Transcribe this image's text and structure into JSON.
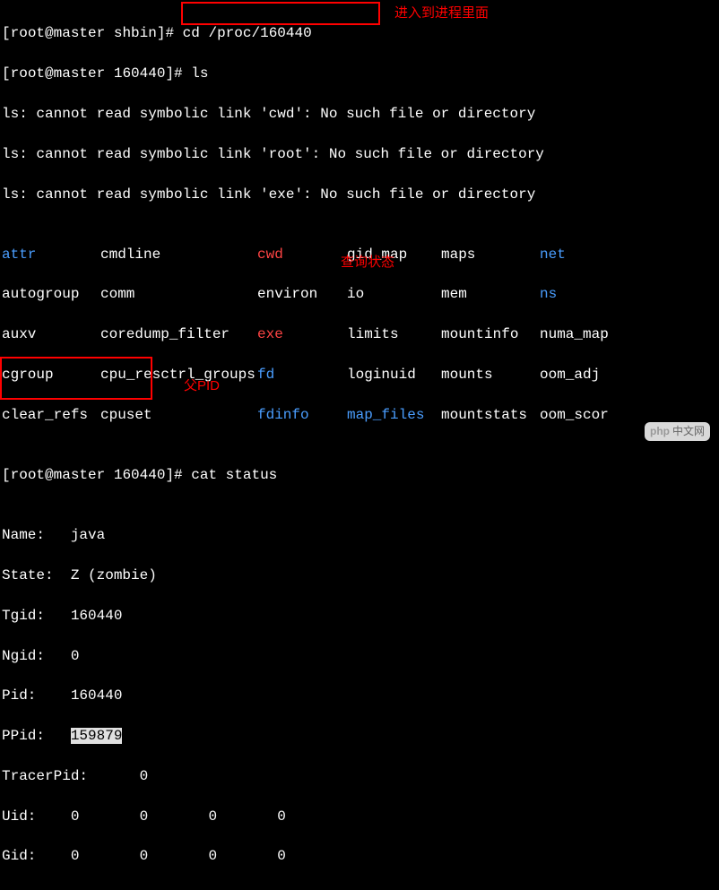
{
  "prompts": {
    "p1_user": "root",
    "p1_host": "master",
    "p1_dir": "shbin",
    "p1_cmd": "cd /proc/160440",
    "p2_dir": "160440",
    "p2_cmd": "ls",
    "p3_cmd": "cat status"
  },
  "annotations": {
    "enter_process": "进入到进程里面",
    "query_status": "查询状态",
    "parent_pid": "父PID"
  },
  "errors": {
    "e1": "ls: cannot read symbolic link 'cwd': No such file or directory",
    "e2": "ls: cannot read symbolic link 'root': No such file or directory",
    "e3": "ls: cannot read symbolic link 'exe': No such file or directory"
  },
  "ls": {
    "r1": {
      "c1": "attr",
      "c2": "cmdline",
      "c3": "cwd",
      "c4": "gid_map",
      "c5": "maps",
      "c6": "net"
    },
    "r2": {
      "c1": "autogroup",
      "c2": "comm",
      "c3": "environ",
      "c4": "io",
      "c5": "mem",
      "c6": "ns"
    },
    "r3": {
      "c1": "auxv",
      "c2": "coredump_filter",
      "c3": "exe",
      "c4": "limits",
      "c5": "mountinfo",
      "c6": "numa_map"
    },
    "r4": {
      "c1": "cgroup",
      "c2": "cpu_resctrl_groups",
      "c3": "fd",
      "c4": "loginuid",
      "c5": "mounts",
      "c6": "oom_adj"
    },
    "r5": {
      "c1": "clear_refs",
      "c2": "cpuset",
      "c3": "fdinfo",
      "c4": "map_files",
      "c5": "mountstats",
      "c6": "oom_scor"
    }
  },
  "status": {
    "name_k": "Name:",
    "name_v": "java",
    "state_k": "State:",
    "state_v": "Z (zombie)",
    "tgid_k": "Tgid:",
    "tgid_v": "160440",
    "ngid_k": "Ngid:",
    "ngid_v": "0",
    "pid_k": "Pid:",
    "pid_v": "160440",
    "ppid_k": "PPid:",
    "ppid_v": "159879",
    "tpid_k": "TracerPid:",
    "tpid_v": "0",
    "uid_k": "Uid:",
    "uid_v1": "0",
    "uid_v2": "0",
    "uid_v3": "0",
    "uid_v4": "0",
    "gid_k": "Gid:",
    "gid_v1": "0",
    "gid_v2": "0",
    "gid_v3": "0",
    "gid_v4": "0"
  },
  "watermark": {
    "logo": "php",
    "text": "中文网"
  }
}
